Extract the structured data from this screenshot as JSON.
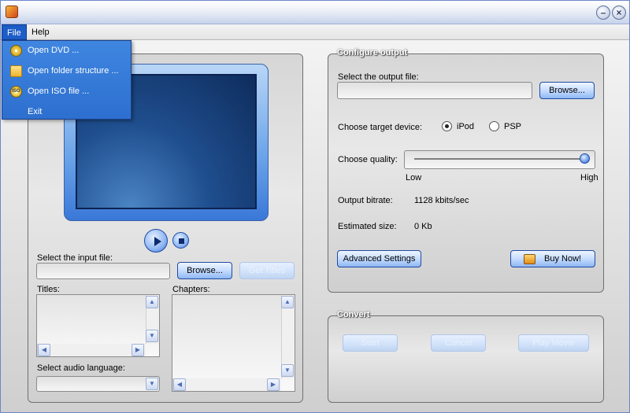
{
  "menu": {
    "file": "File",
    "help": "Help"
  },
  "file_menu": {
    "items": [
      {
        "label": "Open DVD ...",
        "icon": "dvd-disc-icon"
      },
      {
        "label": "Open folder structure ...",
        "icon": "folder-icon"
      },
      {
        "label": "Open ISO file ...",
        "icon": "iso-disc-icon"
      },
      {
        "label": "Exit",
        "icon": ""
      }
    ]
  },
  "input": {
    "select_label": "Select the input file:",
    "value": "",
    "browse_label": "Browse...",
    "get_titles_label": "Get Titles",
    "titles_label": "Titles:",
    "chapters_label": "Chapters:",
    "audio_label": "Select audio language:",
    "audio_value": ""
  },
  "configure": {
    "title": "Configure output",
    "output_label": "Select the output file:",
    "output_value": "",
    "browse_label": "Browse...",
    "device_label": "Choose target device:",
    "devices": [
      "iPod",
      "PSP"
    ],
    "selected_device": "iPod",
    "quality_label": "Choose quality:",
    "quality_low": "Low",
    "quality_high": "High",
    "quality_level": 1.0,
    "bitrate_label": "Output bitrate:",
    "bitrate_value": "1128 kbits/sec",
    "size_label": "Estimated size:",
    "size_value": "0 Kb",
    "advanced_label": "Advanced Settings",
    "buy_label": "Buy Now!"
  },
  "convert": {
    "title": "Convert",
    "start_label": "Start",
    "cancel_label": "Cancel",
    "play_label": "Play Movie"
  },
  "colors": {
    "accent": "#2d6fcf",
    "title_blue": "#1c5dc8"
  }
}
